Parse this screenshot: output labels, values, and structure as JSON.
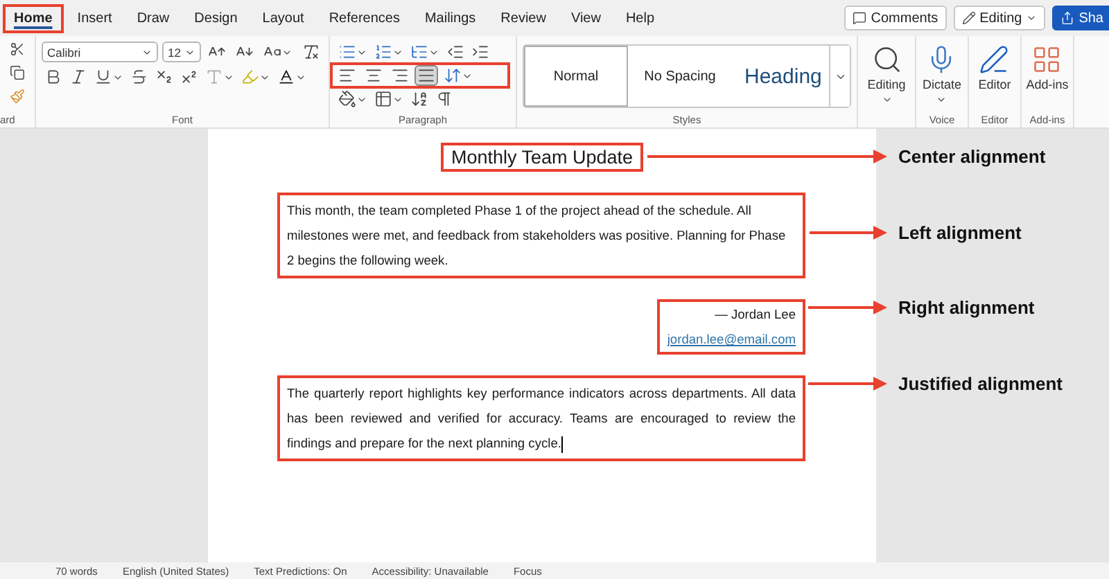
{
  "tabs": [
    {
      "label": "Home",
      "selected": true,
      "highlighted": true
    },
    {
      "label": "Insert",
      "selected": false,
      "highlighted": false
    },
    {
      "label": "Draw",
      "selected": false,
      "highlighted": false
    },
    {
      "label": "Design",
      "selected": false,
      "highlighted": false
    },
    {
      "label": "Layout",
      "selected": false,
      "highlighted": false
    },
    {
      "label": "References",
      "selected": false,
      "highlighted": false
    },
    {
      "label": "Mailings",
      "selected": false,
      "highlighted": false
    },
    {
      "label": "Review",
      "selected": false,
      "highlighted": false
    },
    {
      "label": "View",
      "selected": false,
      "highlighted": false
    },
    {
      "label": "Help",
      "selected": false,
      "highlighted": false
    }
  ],
  "header_buttons": [
    {
      "kind": "comments",
      "label": "Comments"
    },
    {
      "kind": "editing",
      "label": "Editing"
    },
    {
      "kind": "share",
      "label": "Sha"
    }
  ],
  "ribbon": {
    "clipboard_label": "ard",
    "font_label": "Font",
    "paragraph_label": "Paragraph",
    "styles_label": "Styles",
    "font": {
      "name": "Calibri",
      "size": "12"
    },
    "alignment": {
      "highlighted": true,
      "buttons": [
        {
          "kind": "left",
          "selected": false
        },
        {
          "kind": "center",
          "selected": false
        },
        {
          "kind": "right",
          "selected": false
        },
        {
          "kind": "justify",
          "selected": true
        }
      ]
    },
    "styles": [
      {
        "label": "Normal",
        "kind": "normal",
        "selected": true
      },
      {
        "label": "No Spacing",
        "kind": "plain",
        "selected": false
      },
      {
        "label": "Heading",
        "kind": "heading",
        "selected": false
      }
    ],
    "commands": [
      {
        "kind": "search",
        "label": "Editing",
        "dropdown": true
      },
      {
        "kind": "mic",
        "label": "Dictate",
        "dropdown": true,
        "group": "Voice"
      },
      {
        "kind": "pen",
        "label": "Editor",
        "dropdown": false,
        "group": "Editor"
      },
      {
        "kind": "grid",
        "label": "Add-ins",
        "dropdown": false,
        "group": "Add-ins"
      }
    ]
  },
  "document": {
    "blocks": [
      {
        "kind": "title",
        "text": "Monthly Team Update"
      },
      {
        "kind": "paragraph",
        "text": "This month, the team completed Phase 1 of the project ahead of the schedule. All milestones were met, and feedback from stakeholders was positive. Planning for Phase 2 begins the following week."
      },
      {
        "kind": "signature",
        "name": "— Jordan Lee",
        "email": "jordan.lee@email.com"
      },
      {
        "kind": "justified_paragraph",
        "text": "The quarterly report highlights key performance indicators across departments. All data has been reviewed and verified for accuracy. Teams are encouraged to review the findings and prepare for the next planning cycle."
      }
    ]
  },
  "annotations": [
    {
      "label": "Center alignment"
    },
    {
      "label": "Left alignment"
    },
    {
      "label": "Right alignment"
    },
    {
      "label": "Justified alignment"
    }
  ],
  "status_bar": [
    "70 words",
    "English (United States)",
    "Text Predictions: On",
    "Accessibility: Unavailable",
    "Focus"
  ]
}
